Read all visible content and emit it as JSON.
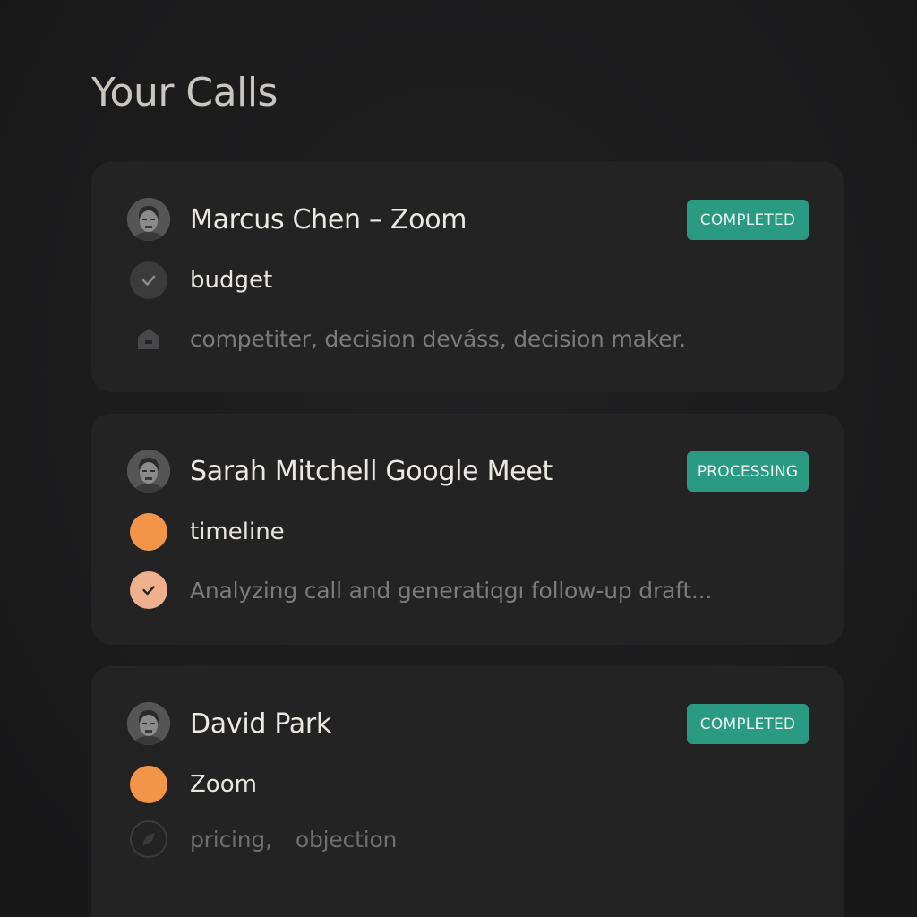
{
  "page": {
    "title": "Your Calls"
  },
  "colors": {
    "background": "#1b1b1c",
    "card": "#232324",
    "badge": "#2a9a82",
    "orange": "#f39549",
    "peach": "#efb08d",
    "muted_text": "#7b7b7c"
  },
  "calls": [
    {
      "title": "Marcus Chen – Zoom",
      "status": "COMPLETED",
      "avatar_icon": "person-avatar-icon",
      "primary": {
        "icon": "check-circle-icon",
        "text": "budget"
      },
      "secondary": {
        "icon": "house-icon",
        "text": "competiter, decision deváss, decision maker."
      }
    },
    {
      "title": "Sarah Mitchell Google Meet",
      "status": "PROCESSING",
      "avatar_icon": "person-avatar-icon",
      "primary": {
        "icon": "orange-dot-icon",
        "text": "timeline"
      },
      "secondary": {
        "icon": "check-circle-icon",
        "text": "Analyzing call and generatiqgı follow-up draft..."
      }
    },
    {
      "title": "David Park",
      "status": "COMPLETED",
      "avatar_icon": "person-avatar-icon",
      "primary": {
        "icon": "orange-dot-icon",
        "text": "Zoom"
      },
      "secondary": {
        "icon": "leaf-circle-icon",
        "text_1": "pricing,",
        "text_2": "objection"
      }
    }
  ]
}
